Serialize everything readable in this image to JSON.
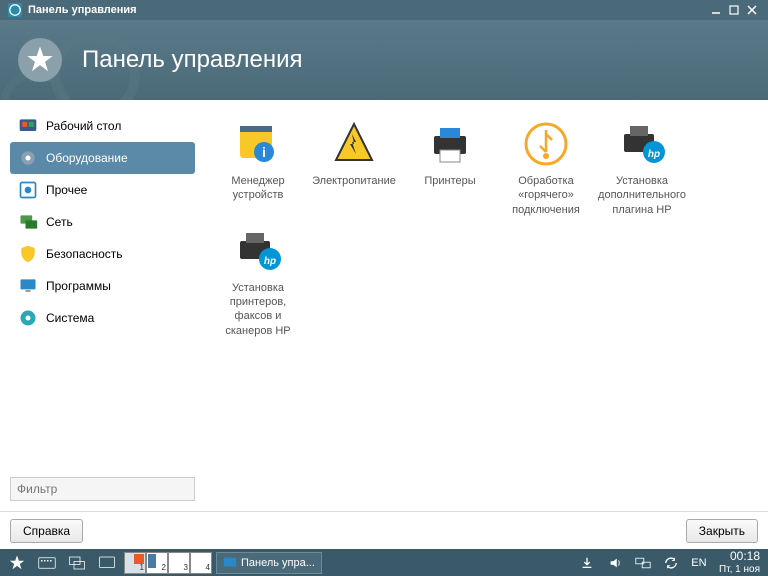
{
  "titlebar": {
    "title": "Панель управления"
  },
  "header": {
    "title": "Панель управления"
  },
  "sidebar": {
    "items": [
      {
        "label": "Рабочий стол"
      },
      {
        "label": "Оборудование"
      },
      {
        "label": "Прочее"
      },
      {
        "label": "Сеть"
      },
      {
        "label": "Безопасность"
      },
      {
        "label": "Программы"
      },
      {
        "label": "Система"
      }
    ],
    "filter_placeholder": "Фильтр"
  },
  "main": {
    "items": [
      {
        "label": "Менеджер устройств"
      },
      {
        "label": "Электропитание"
      },
      {
        "label": "Принтеры"
      },
      {
        "label": "Обработка «горячего» подключения"
      },
      {
        "label": "Установка дополнительного плагина HP"
      },
      {
        "label": "Установка принтеров, факсов и сканеров HP"
      }
    ]
  },
  "footer": {
    "help": "Справка",
    "close": "Закрыть"
  },
  "taskbar": {
    "app": "Панель упра...",
    "lang": "EN",
    "time": "00:18",
    "date": "Пт, 1 ноя",
    "pager": [
      "1",
      "2",
      "3",
      "4"
    ]
  }
}
